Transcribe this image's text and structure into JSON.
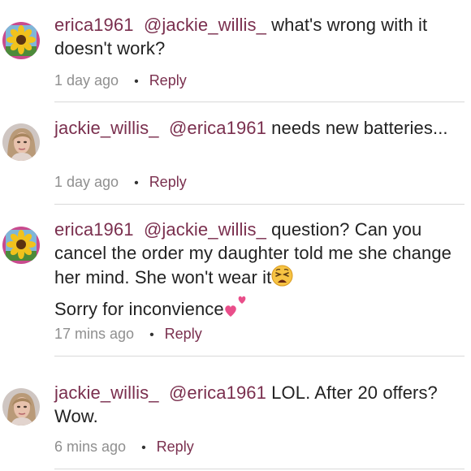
{
  "comments": [
    {
      "username": "erica1961",
      "mention": "@jackie_willis_",
      "text": " what's wrong with it doesn't work?",
      "time": "1 day ago",
      "separator": "•",
      "reply_label": "Reply"
    },
    {
      "username": "jackie_willis_",
      "mention": "@erica1961",
      "text": " needs new batteries...",
      "time": "1 day ago",
      "separator": "•",
      "reply_label": "Reply"
    },
    {
      "username": "erica1961",
      "mention": "@jackie_willis_",
      "text": " question? Can you cancel the order my daughter told me she change her mind. She won't wear it",
      "text_after": "Sorry for inconvience",
      "time": "17 mins ago",
      "separator": "•",
      "reply_label": "Reply"
    },
    {
      "username": "jackie_willis_",
      "mention": "@erica1961",
      "text": " LOL. After 20 offers? Wow.",
      "time": "6 mins ago",
      "separator": "•",
      "reply_label": "Reply"
    }
  ],
  "colors": {
    "username": "#7a2f4e",
    "reply": "#7a2f4e",
    "meta": "#8f8f8f",
    "divider": "#d9d9d9"
  },
  "icons": {
    "erica_avatar": "sunflower-avatar",
    "jackie_avatar": "woman-portrait-avatar",
    "weary_emoji": "weary-face-emoji",
    "heart_emoji": "two-hearts-emoji"
  }
}
